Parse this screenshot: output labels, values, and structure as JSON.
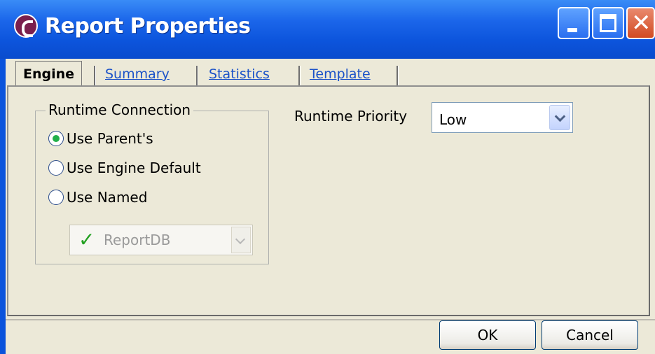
{
  "window": {
    "title": "Report Properties",
    "icon": "report-app-icon",
    "controls": [
      "minimize-icon",
      "maximize-icon",
      "close-icon"
    ]
  },
  "tabs": [
    {
      "label": "Engine",
      "active": true
    },
    {
      "label": "Summary",
      "active": false
    },
    {
      "label": "Statistics",
      "active": false
    },
    {
      "label": "Template",
      "active": false
    }
  ],
  "runtime_connection": {
    "legend": "Runtime Connection",
    "options": [
      {
        "label": "Use Parent's",
        "selected": true
      },
      {
        "label": "Use Engine Default",
        "selected": false
      },
      {
        "label": "Use Named",
        "selected": false
      }
    ],
    "named_value": "ReportDB",
    "named_enabled": false
  },
  "runtime_priority": {
    "label": "Runtime Priority",
    "value": "Low"
  },
  "buttons": {
    "ok": "OK",
    "cancel": "Cancel"
  },
  "colors": {
    "titlebar": "#0a53dc",
    "dialog_bg": "#ece9d8",
    "tab_inactive": "#1b52c8",
    "radio_selected": "#22b04a",
    "check": "#22a020"
  }
}
